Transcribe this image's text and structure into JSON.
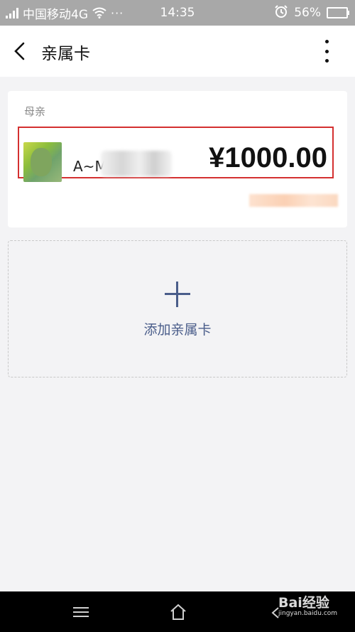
{
  "status_bar": {
    "carrier": "中国移动4G",
    "more": "···",
    "time": "14:35",
    "battery": "56%",
    "battery_level": 0.56
  },
  "header": {
    "title": "亲属卡"
  },
  "family_card": {
    "relation_label": "母亲",
    "contact_name": "A~M",
    "amount": "¥1000.00"
  },
  "add_card": {
    "label": "添加亲属卡"
  },
  "watermark": {
    "text": "Bai经验",
    "sub": "jingyan.baidu.com"
  },
  "colors": {
    "accent": "#4a5d8a",
    "highlight_border": "#d43030",
    "status_bar": "#a8a8a8"
  }
}
